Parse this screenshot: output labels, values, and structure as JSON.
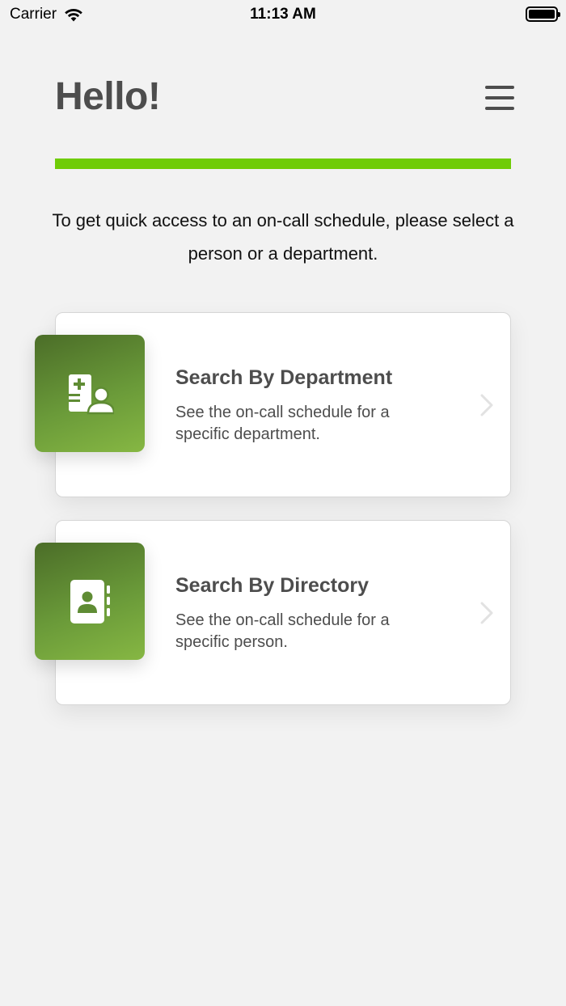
{
  "status_bar": {
    "carrier": "Carrier",
    "time": "11:13 AM"
  },
  "header": {
    "greeting": "Hello!"
  },
  "colors": {
    "accent": "#6fcc07",
    "tile_dark": "#4b6d28",
    "tile_light": "#86b743",
    "text": "#4d4d4d",
    "background": "#f2f2f2"
  },
  "intro_text": "To get quick access to an on-call schedule, please select a person or a department.",
  "cards": [
    {
      "title": "Search By Department",
      "description": "See the on-call schedule for a specific department.",
      "icon": "medical-staff-icon"
    },
    {
      "title": "Search By Directory",
      "description": "See the on-call schedule for a specific person.",
      "icon": "contact-book-icon"
    }
  ]
}
